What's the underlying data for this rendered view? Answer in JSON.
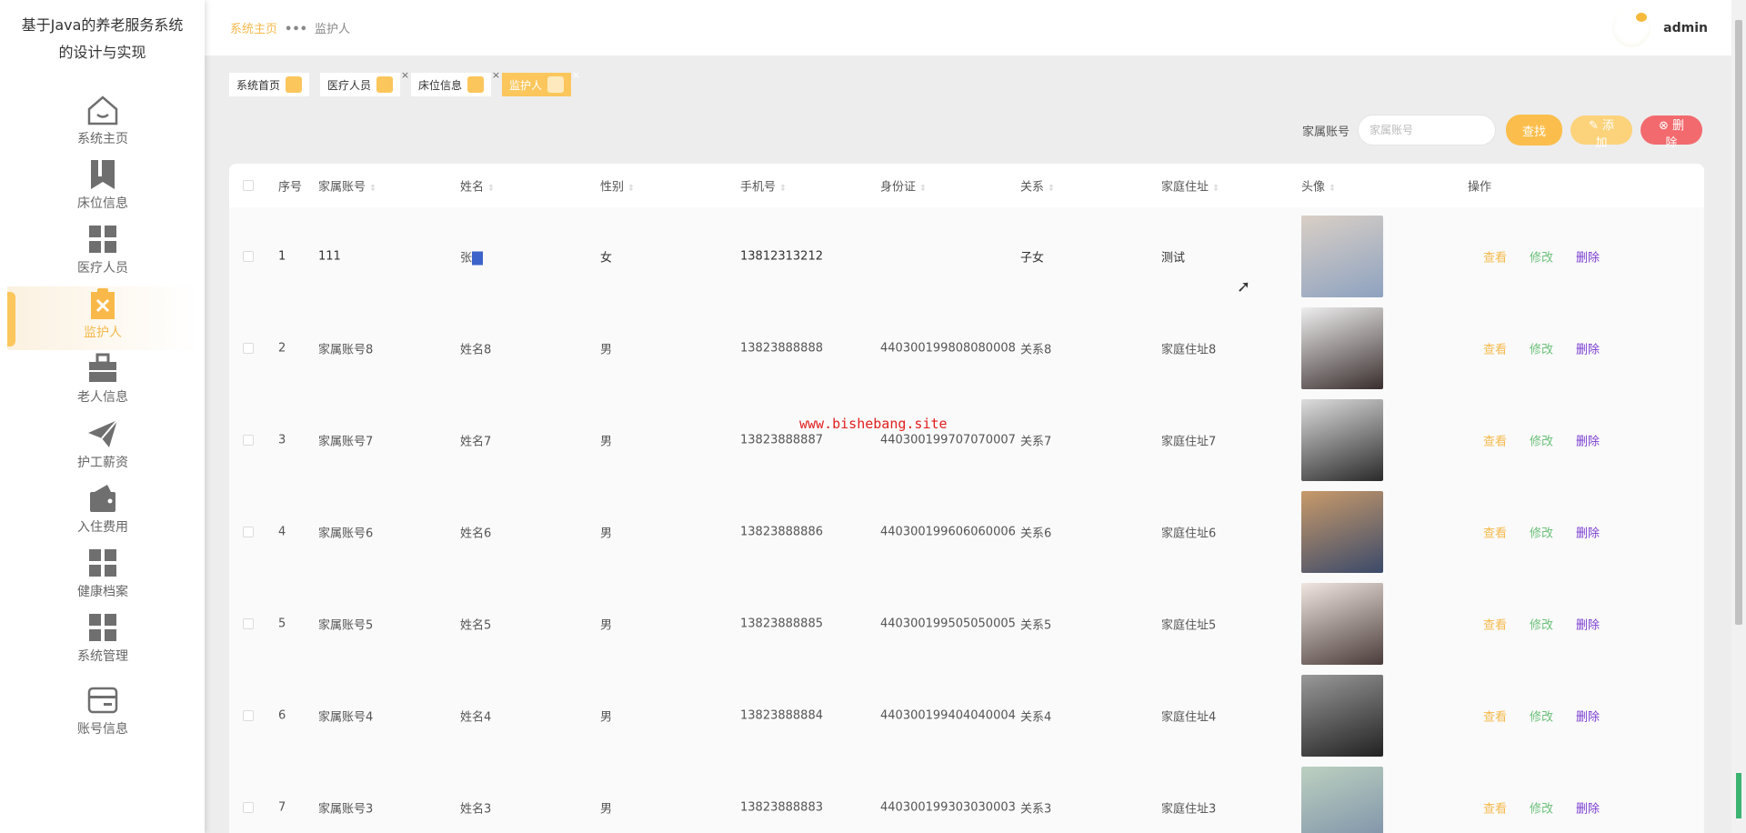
{
  "app": {
    "title_line1": "基于Java的养老服务系统",
    "title_line2": "的设计与实现"
  },
  "sidebar": {
    "items": [
      {
        "label": "系统主页",
        "icon": "home-icon"
      },
      {
        "label": "床位信息",
        "icon": "bookmark-icon"
      },
      {
        "label": "医疗人员",
        "icon": "grid-icon"
      },
      {
        "label": "监护人",
        "icon": "clipboard-x-icon",
        "active": true
      },
      {
        "label": "老人信息",
        "icon": "briefcase-icon"
      },
      {
        "label": "护工薪资",
        "icon": "paper-plane-icon"
      },
      {
        "label": "入住费用",
        "icon": "wallet-icon"
      },
      {
        "label": "健康档案",
        "icon": "grid-icon"
      },
      {
        "label": "系统管理",
        "icon": "grid-icon"
      },
      {
        "label": "账号信息",
        "icon": "card-icon"
      }
    ]
  },
  "header": {
    "breadcrumb_home": "系统主页",
    "breadcrumb_sep": "•••",
    "breadcrumb_current": "监护人",
    "username": "admin"
  },
  "tags": [
    {
      "label": "系统首页"
    },
    {
      "label": "医疗人员",
      "close": "×"
    },
    {
      "label": "床位信息",
      "close": "×"
    },
    {
      "label": "监护人",
      "close": "×",
      "active": true
    }
  ],
  "search": {
    "label": "家属账号",
    "placeholder": "家属账号",
    "value": "",
    "find": "查找",
    "add": "添加",
    "delete": "删除",
    "add_icon": "✎",
    "delete_icon": "⊗"
  },
  "table": {
    "columns": [
      "序号",
      "家属账号",
      "姓名",
      "性别",
      "手机号",
      "身份证",
      "关系",
      "家庭住址",
      "头像",
      "操作"
    ],
    "actions": {
      "view": "查看",
      "edit": "修改",
      "delete": "删除"
    },
    "rows": [
      {
        "no": "1",
        "account": "111",
        "name": "张",
        "gender": "女",
        "phone": "13812313212",
        "idcard": "",
        "relation": "子女",
        "address": "测试"
      },
      {
        "no": "2",
        "account": "家属账号8",
        "name": "姓名8",
        "gender": "男",
        "phone": "13823888888",
        "idcard": "440300199808080008",
        "relation": "关系8",
        "address": "家庭住址8"
      },
      {
        "no": "3",
        "account": "家属账号7",
        "name": "姓名7",
        "gender": "男",
        "phone": "13823888887",
        "idcard": "440300199707070007",
        "relation": "关系7",
        "address": "家庭住址7"
      },
      {
        "no": "4",
        "account": "家属账号6",
        "name": "姓名6",
        "gender": "男",
        "phone": "13823888886",
        "idcard": "440300199606060006",
        "relation": "关系6",
        "address": "家庭住址6"
      },
      {
        "no": "5",
        "account": "家属账号5",
        "name": "姓名5",
        "gender": "男",
        "phone": "13823888885",
        "idcard": "440300199505050005",
        "relation": "关系5",
        "address": "家庭住址5"
      },
      {
        "no": "6",
        "account": "家属账号4",
        "name": "姓名4",
        "gender": "男",
        "phone": "13823888884",
        "idcard": "440300199404040004",
        "relation": "关系4",
        "address": "家庭住址4"
      },
      {
        "no": "7",
        "account": "家属账号3",
        "name": "姓名3",
        "gender": "男",
        "phone": "13823888883",
        "idcard": "440300199303030003",
        "relation": "关系3",
        "address": "家庭住址3"
      }
    ]
  },
  "watermark": "www.bishebang.site",
  "colors": {
    "accent": "#fbc65c",
    "danger": "#f26a6e",
    "edit": "#6cc07a",
    "delete_link": "#7a3dd1"
  }
}
